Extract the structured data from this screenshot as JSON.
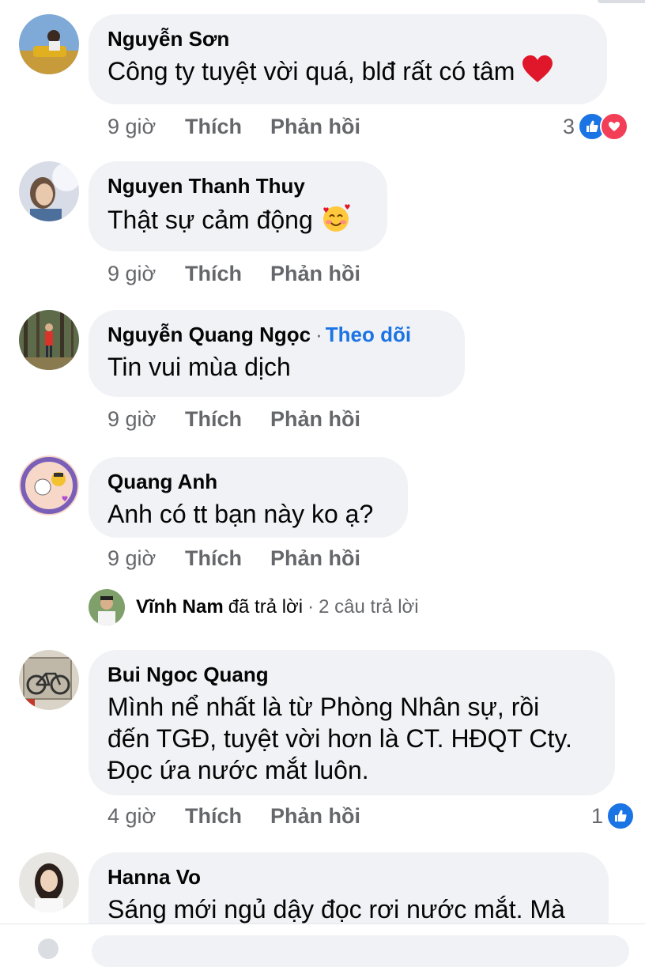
{
  "comments": [
    {
      "author": "Nguyễn Sơn",
      "text": "Công ty tuyệt vời quá, blđ rất có tâm",
      "emoji": "red-heart",
      "time": "9 giờ",
      "like_label": "Thích",
      "reply_label": "Phản hồi",
      "reaction_count": "3",
      "reactions": [
        "like-icon",
        "love-icon"
      ]
    },
    {
      "author": "Nguyen Thanh Thuy",
      "text": "Thật sự cảm động",
      "emoji": "smiling-face-with-hearts",
      "time": "9 giờ",
      "like_label": "Thích",
      "reply_label": "Phản hồi"
    },
    {
      "author": "Nguyễn Quang Ngọc",
      "separator": "·",
      "follow_label": "Theo dõi",
      "text": "Tin vui mùa dịch",
      "time": "9 giờ",
      "like_label": "Thích",
      "reply_label": "Phản hồi"
    },
    {
      "author": "Quang Anh",
      "text": "Anh có tt bạn này ko ạ?",
      "time": "9 giờ",
      "like_label": "Thích",
      "reply_label": "Phản hồi",
      "replies_preview": {
        "replier": "Vĩnh Nam",
        "verb": "đã trả lời",
        "separator": "·",
        "count_label": "2 câu trả lời"
      }
    },
    {
      "author": "Bui Ngoc Quang",
      "text_lines": [
        "Mình nể nhất là từ Phòng Nhân sự, rồi",
        "đến TGĐ, tuyệt vời hơn là CT. HĐQT Cty.",
        "Đọc ứa nước mắt luôn."
      ],
      "time": "4 giờ",
      "like_label": "Thích",
      "reply_label": "Phản hồi",
      "reaction_count": "1",
      "reactions": [
        "like-icon"
      ]
    },
    {
      "author": "Hanna Vo",
      "text": "Sáng mới ngủ dậy đọc rơi nước mắt. Mà"
    }
  ],
  "colors": {
    "bubble": "#f0f2f5",
    "secondary_text": "#65676b",
    "link_blue": "#1b74e4",
    "love_red": "#f33e58"
  }
}
